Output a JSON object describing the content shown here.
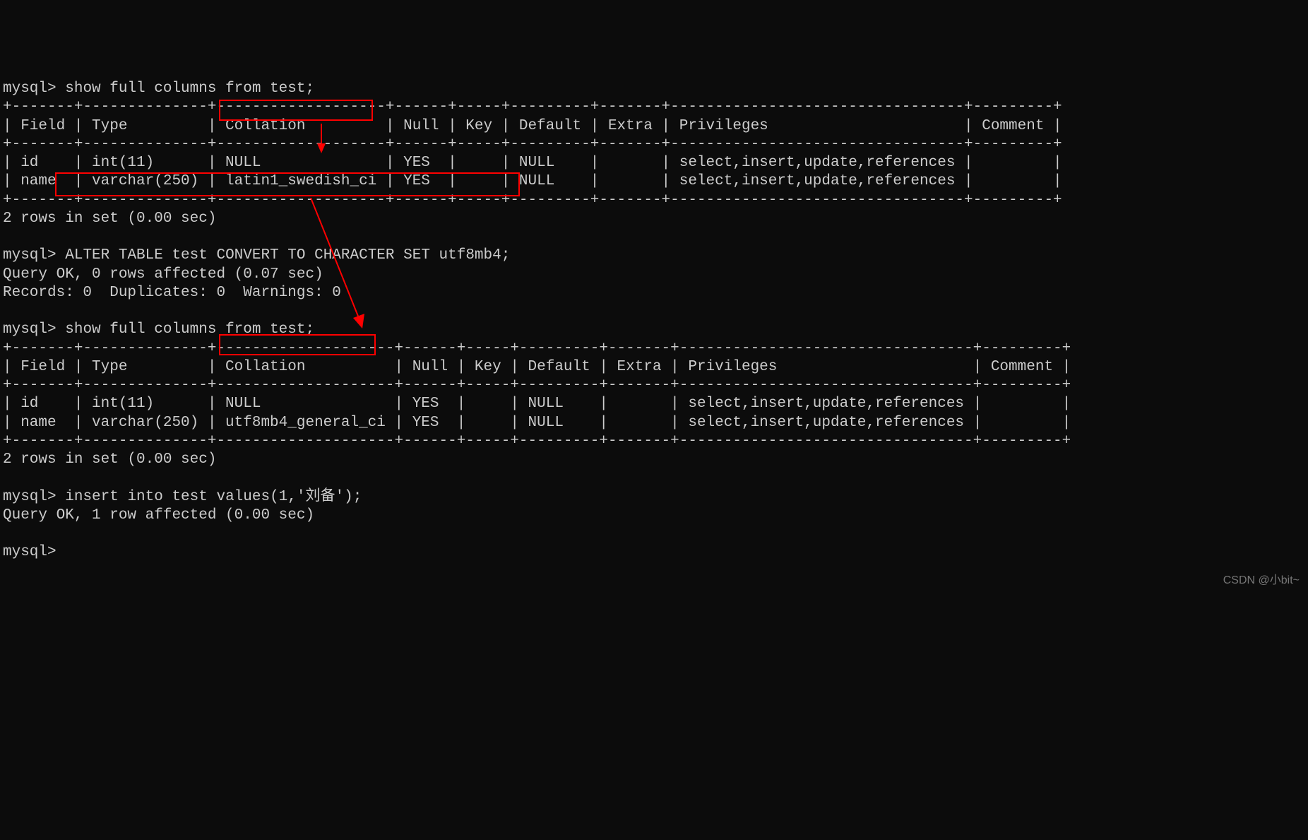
{
  "prompt": "mysql>",
  "commands": {
    "show_columns": "show full columns from test;",
    "alter_table": "ALTER TABLE test CONVERT TO CHARACTER SET utf8mb4;",
    "insert": "insert into test values(1,'刘备');"
  },
  "table_border_top": "+-------+--------------+-------------------+------+-----+---------+-------+---------------------------------+---------+",
  "table_border_top2": "+-------+--------------+--------------------+------+-----+---------+-------+---------------------------------+---------+",
  "headers": {
    "field": "Field",
    "type": "Type",
    "collation": "Collation",
    "null": "Null",
    "key": "Key",
    "default": "Default",
    "extra": "Extra",
    "privileges": "Privileges",
    "comment": "Comment"
  },
  "table1_header_row": "| Field | Type         | Collation         | Null | Key | Default | Extra | Privileges                      | Comment |",
  "table1_row1": "| id    | int(11)      | NULL              | YES  |     | NULL    |       | select,insert,update,references |         |",
  "table1_row2": "| name  | varchar(250) | latin1_swedish_ci | YES  |     | NULL    |       | select,insert,update,references |         |",
  "table2_header_row": "| Field | Type         | Collation          | Null | Key | Default | Extra | Privileges                      | Comment |",
  "table2_row1": "| id    | int(11)      | NULL               | YES  |     | NULL    |       | select,insert,update,references |         |",
  "table2_row2": "| name  | varchar(250) | utf8mb4_general_ci | YES  |     | NULL    |       | select,insert,update,references |         |",
  "results": {
    "rows_in_set": "2 rows in set (0.00 sec)",
    "query_ok_alter": "Query OK, 0 rows affected (0.07 sec)",
    "records": "Records: 0  Duplicates: 0  Warnings: 0",
    "query_ok_insert": "Query OK, 1 row affected (0.00 sec)"
  },
  "data_table1": {
    "columns": [
      "Field",
      "Type",
      "Collation",
      "Null",
      "Key",
      "Default",
      "Extra",
      "Privileges",
      "Comment"
    ],
    "rows": [
      {
        "Field": "id",
        "Type": "int(11)",
        "Collation": "NULL",
        "Null": "YES",
        "Key": "",
        "Default": "NULL",
        "Extra": "",
        "Privileges": "select,insert,update,references",
        "Comment": ""
      },
      {
        "Field": "name",
        "Type": "varchar(250)",
        "Collation": "latin1_swedish_ci",
        "Null": "YES",
        "Key": "",
        "Default": "NULL",
        "Extra": "",
        "Privileges": "select,insert,update,references",
        "Comment": ""
      }
    ]
  },
  "data_table2": {
    "columns": [
      "Field",
      "Type",
      "Collation",
      "Null",
      "Key",
      "Default",
      "Extra",
      "Privileges",
      "Comment"
    ],
    "rows": [
      {
        "Field": "id",
        "Type": "int(11)",
        "Collation": "NULL",
        "Null": "YES",
        "Key": "",
        "Default": "NULL",
        "Extra": "",
        "Privileges": "select,insert,update,references",
        "Comment": ""
      },
      {
        "Field": "name",
        "Type": "varchar(250)",
        "Collation": "utf8mb4_general_ci",
        "Null": "YES",
        "Key": "",
        "Default": "NULL",
        "Extra": "",
        "Privileges": "select,insert,update,references",
        "Comment": ""
      }
    ]
  },
  "watermark": "CSDN @小bit~",
  "empty": ""
}
